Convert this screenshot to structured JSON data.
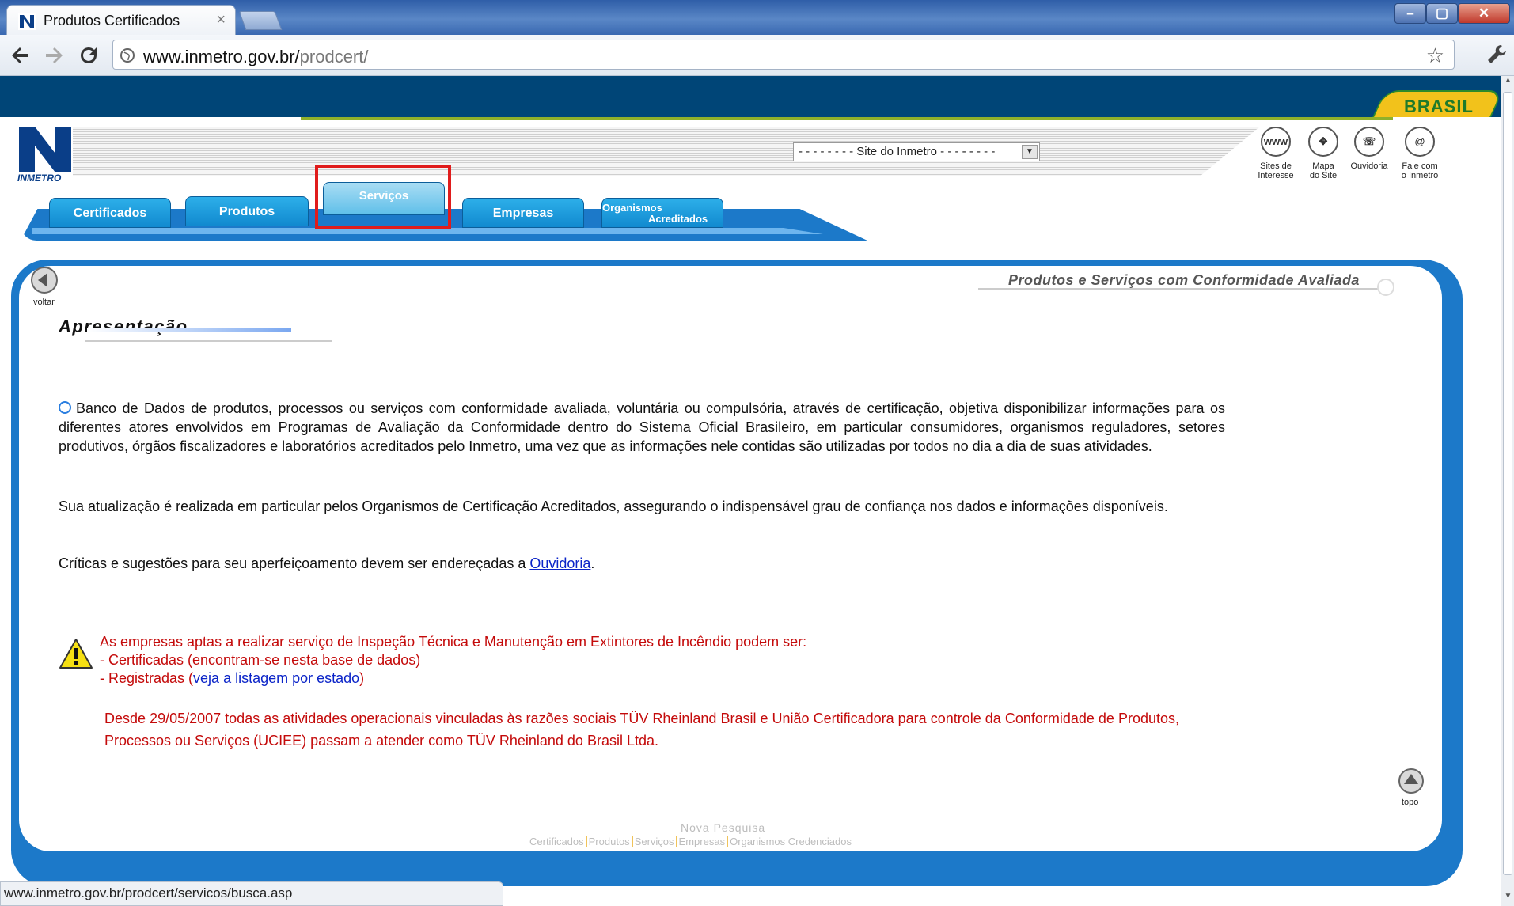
{
  "browser": {
    "tab_title": "Produtos Certificados",
    "tab_close": "×",
    "url_host": "www.inmetro.gov.br/",
    "url_path": "prodcert/",
    "status_url": "www.inmetro.gov.br/prodcert/servicos/busca.asp",
    "window_min": "–",
    "window_max": "▢",
    "window_close": "✕"
  },
  "header": {
    "brasil": "BRASIL",
    "logo_text": "INMETRO",
    "site_select": "- - - - - - - - Site do Inmetro - - - - - - - -",
    "icons": [
      {
        "glyph": "www",
        "label_1": "Sites de",
        "label_2": "Interesse"
      },
      {
        "glyph": "✥",
        "label_1": "Mapa",
        "label_2": "do Site"
      },
      {
        "glyph": "☏",
        "label_1": "Ouvidoria",
        "label_2": ""
      },
      {
        "glyph": "@",
        "label_1": "Fale com",
        "label_2": "o Inmetro"
      }
    ]
  },
  "menu": {
    "certificados": "Certificados",
    "produtos": "Produtos",
    "servicos": "Serviços",
    "empresas": "Empresas",
    "organismos_1": "Organismos",
    "organismos_2": "Acreditados"
  },
  "content": {
    "voltar": "voltar",
    "heading": "Produtos e Serviços com Conformidade Avaliada",
    "title": "Apresentação",
    "para1": "Banco de Dados de produtos, processos ou serviços com conformidade avaliada, voluntária ou compulsória, através de certificação, objetiva disponibilizar informações para os diferentes atores envolvidos em Programas de Avaliação da Conformidade dentro do Sistema Oficial Brasileiro, em particular consumidores, organismos reguladores, setores produtivos, órgãos fiscalizadores e laboratórios acreditados pelo Inmetro, uma vez que as informações nele contidas são utilizadas por todos no dia a dia de suas atividades.",
    "para2": "Sua atualização é realizada em particular pelos Organismos de Certificação Acreditados, assegurando o indispensável grau de confiança nos dados e informações disponíveis.",
    "para3_prefix": "Críticas e sugestões para seu aperfeiçoamento devem ser endereçadas a ",
    "para3_link": "Ouvidoria",
    "para3_suffix": ".",
    "warn_1": "As empresas aptas a realizar serviço de Inspeção Técnica e Manutenção em Extintores de Incêndio podem ser:",
    "warn_2": "- Certificadas (encontram-se nesta base de dados)",
    "warn_3_prefix": "- Registradas (",
    "warn_3_link": "veja a listagem por estado",
    "warn_3_suffix": ")",
    "notice": "Desde 29/05/2007 todas as atividades operacionais vinculadas às razões sociais TÜV Rheinland Brasil e União Certificadora para controle da Conformidade de Produtos, Processos ou Serviços (UCIEE) passam a atender como TÜV Rheinland do Brasil Ltda.",
    "topo": "topo"
  },
  "footer": {
    "nova_pesquisa": "Nova Pesquisa",
    "links": [
      "Certificados",
      "Produtos",
      "Serviços",
      "Empresas",
      "Organismos Credenciados"
    ]
  },
  "colors": {
    "gov_blue": "#004577",
    "menu_blue": "#1c79c9",
    "highlight": "#e01c1c",
    "alert_red": "#c40a0a"
  }
}
